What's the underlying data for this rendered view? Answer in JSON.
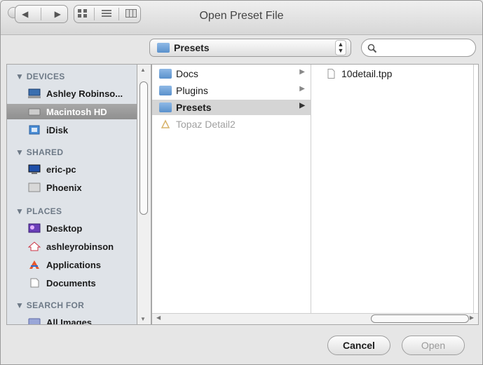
{
  "window": {
    "title": "Open Preset File"
  },
  "toolbar": {
    "back_forward": [
      "◀",
      "▶"
    ],
    "view_modes": [
      "icon-view",
      "list-view",
      "column-view"
    ],
    "location": "Presets",
    "search_placeholder": ""
  },
  "sidebar": {
    "devices": {
      "heading": "▼ DEVICES",
      "items": [
        {
          "label": "Ashley Robinso...",
          "icon": "computer-icon"
        },
        {
          "label": "Macintosh HD",
          "icon": "hard-drive-icon"
        },
        {
          "label": "iDisk",
          "icon": "idisk-icon"
        }
      ]
    },
    "shared": {
      "heading": "▼ SHARED",
      "items": [
        {
          "label": "eric-pc",
          "icon": "pc-icon"
        },
        {
          "label": "Phoenix",
          "icon": "server-icon"
        }
      ]
    },
    "places": {
      "heading": "▼ PLACES",
      "items": [
        {
          "label": "Desktop",
          "icon": "desktop-icon"
        },
        {
          "label": "ashleyrobinson",
          "icon": "home-icon"
        },
        {
          "label": "Applications",
          "icon": "applications-icon"
        },
        {
          "label": "Documents",
          "icon": "documents-icon"
        }
      ]
    },
    "search_for": {
      "heading": "▼ SEARCH FOR",
      "items": [
        {
          "label": "All Images",
          "icon": "smart-folder-icon"
        }
      ]
    }
  },
  "browser": {
    "column1": [
      {
        "label": "Docs",
        "icon": "folder-icon"
      },
      {
        "label": "Plugins",
        "icon": "folder-icon"
      },
      {
        "label": "Presets",
        "icon": "folder-icon"
      },
      {
        "label": "Topaz Detail2",
        "icon": "app-icon"
      }
    ],
    "column2": [
      {
        "label": "10detail.tpp",
        "icon": "document-icon"
      }
    ]
  },
  "buttons": {
    "cancel": "Cancel",
    "open": "Open"
  },
  "colors": {
    "selection": "#d5d5d5",
    "sidebar_bg": "#dfe3e8",
    "sidebar_selected": "#9a9a9a"
  }
}
